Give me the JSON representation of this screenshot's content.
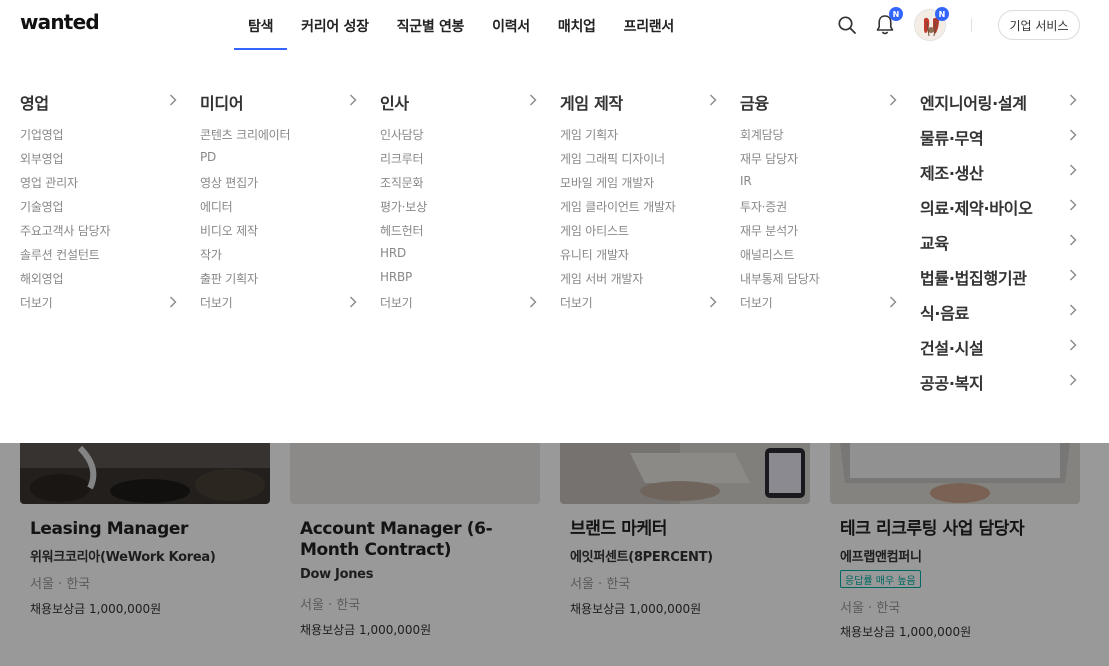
{
  "header": {
    "logo": "wanted",
    "nav": [
      "탐색",
      "커리어 성장",
      "직군별 연봉",
      "이력서",
      "매치업",
      "프리랜서"
    ],
    "active_nav": "탐색",
    "notification_badge": "N",
    "profile_badge": "N",
    "corp_button": "기업 서비스"
  },
  "mega_menu": {
    "columns": [
      {
        "title": "영업",
        "items": [
          "기업영업",
          "외부영업",
          "영업 관리자",
          "기술영업",
          "주요고객사 담당자",
          "솔루션 컨설턴트",
          "해외영업"
        ],
        "more": "더보기"
      },
      {
        "title": "미디어",
        "items": [
          "콘텐츠 크리에이터",
          "PD",
          "영상 편집가",
          "에디터",
          "비디오 제작",
          "작가",
          "출판 기획자"
        ],
        "more": "더보기"
      },
      {
        "title": "인사",
        "items": [
          "인사담당",
          "리크루터",
          "조직문화",
          "평가·보상",
          "헤드헌터",
          "HRD",
          "HRBP"
        ],
        "more": "더보기"
      },
      {
        "title": "게임 제작",
        "items": [
          "게임 기획자",
          "게임 그래픽 디자이너",
          "모바일 게임 개발자",
          "게임 클라이언트 개발자",
          "게임 아티스트",
          "유니티 개발자",
          "게임 서버 개발자"
        ],
        "more": "더보기"
      },
      {
        "title": "금융",
        "items": [
          "회계담당",
          "재무 담당자",
          "IR",
          "투자·증권",
          "재무 분석가",
          "애널리스트",
          "내부통제 담당자"
        ],
        "more": "더보기"
      }
    ],
    "big_list": [
      "엔지니어링·설계",
      "물류·무역",
      "제조·생산",
      "의료·제약·바이오",
      "교육",
      "법률·법집행기관",
      "식·음료",
      "건설·시설",
      "공공·복지"
    ]
  },
  "jobs": [
    {
      "title": "Leasing Manager",
      "company": "위워크코리아(WeWork Korea)",
      "location": "서울 · 한국",
      "reward": "채용보상금 1,000,000원",
      "tag": ""
    },
    {
      "title": "Account Manager (6-Month Contract)",
      "company": "Dow Jones",
      "location": "서울 · 한국",
      "reward": "채용보상금 1,000,000원",
      "tag": ""
    },
    {
      "title": "브랜드 마케터",
      "company": "에잇퍼센트(8PERCENT)",
      "location": "서울 · 한국",
      "reward": "채용보상금 1,000,000원",
      "tag": ""
    },
    {
      "title": "테크 리크루팅 사업 담당자",
      "company": "에프랩앤컴퍼니",
      "location": "서울 · 한국",
      "reward": "채용보상금 1,000,000원",
      "tag": "응답률 매우 높음"
    }
  ],
  "colors": {
    "accent": "#3366ff",
    "tag": "#00aea4",
    "overlay": "rgba(0,0,0,0.4)"
  }
}
